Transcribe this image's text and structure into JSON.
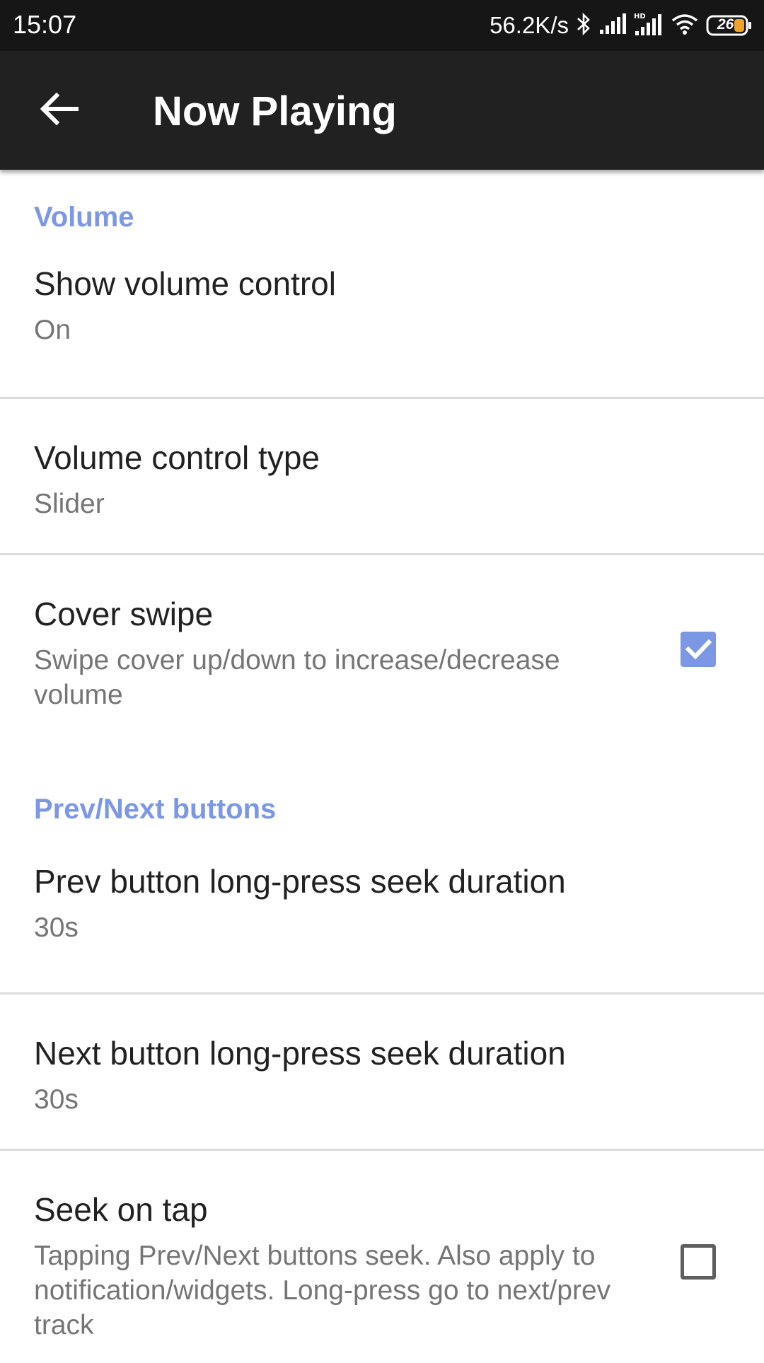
{
  "status_bar": {
    "time": "15:07",
    "network_speed": "56.2K/s",
    "battery_level": "26",
    "icons": [
      "bluetooth-icon",
      "signal-icon",
      "hd-signal-icon",
      "wifi-icon",
      "battery-icon"
    ]
  },
  "app_bar": {
    "back_icon": "arrow-left-icon",
    "title": "Now Playing"
  },
  "sections": {
    "volume": {
      "header": "Volume",
      "show_volume_control": {
        "title": "Show volume control",
        "summary": "On"
      },
      "volume_control_type": {
        "title": "Volume control type",
        "summary": "Slider"
      },
      "cover_swipe": {
        "title": "Cover swipe",
        "summary": "Swipe cover up/down to increase/decrease volume",
        "checked": true
      }
    },
    "prev_next": {
      "header": "Prev/Next buttons",
      "prev_seek": {
        "title": "Prev button long-press seek duration",
        "summary": "30s"
      },
      "next_seek": {
        "title": "Next button long-press seek duration",
        "summary": "30s"
      },
      "seek_on_tap": {
        "title": "Seek on tap",
        "summary": "Tapping Prev/Next buttons seek. Also apply to notification/widgets. Long-press go to next/prev track",
        "checked": false
      }
    }
  },
  "colors": {
    "accent": "#7c97e3",
    "app_bar": "#212121",
    "status_bar": "#161616"
  }
}
